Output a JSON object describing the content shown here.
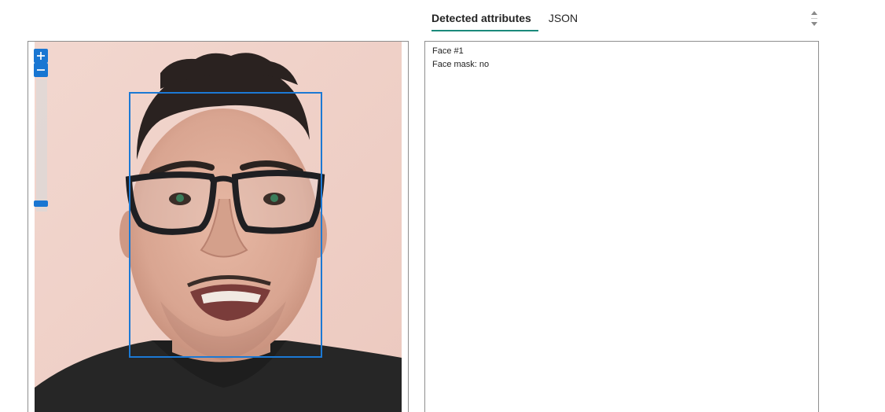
{
  "tabs": [
    {
      "label": "Detected attributes",
      "active": true
    },
    {
      "label": "JSON",
      "active": false
    }
  ],
  "result": {
    "face_label": "Face #1",
    "mask_label": "Face mask: no"
  },
  "colors": {
    "accent_tab": "#1a8a7b",
    "face_box": "#1c79d4",
    "zoom_control": "#1976d2"
  },
  "icons": {
    "zoom_in": "zoom-in-icon",
    "zoom_out": "zoom-out-icon",
    "spinner": "spinner-arrows-icon"
  }
}
